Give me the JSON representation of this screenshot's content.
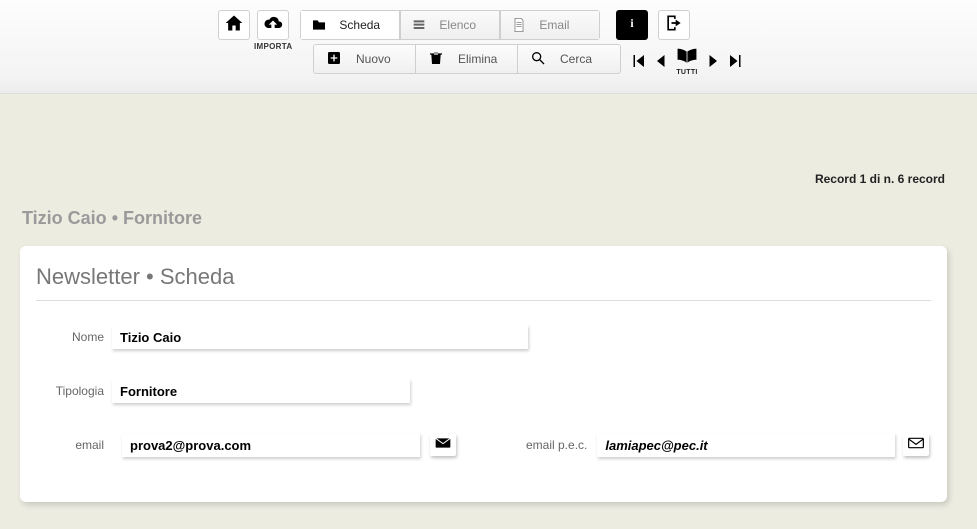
{
  "toolbar": {
    "import_label": "IMPORTA",
    "tabs": {
      "scheda": "Scheda",
      "elenco": "Elenco",
      "email": "Email"
    },
    "actions": {
      "nuovo": "Nuovo",
      "elimina": "Elimina",
      "cerca": "Cerca"
    },
    "tutti_label": "TUTTI"
  },
  "record_counter": "Record 1 di n. 6 record",
  "header": {
    "name": "Tizio Caio",
    "separator": " • ",
    "type": "Fornitore"
  },
  "card": {
    "title": "Newsletter • Scheda",
    "labels": {
      "nome": "Nome",
      "tipologia": "Tipologia",
      "email": "email",
      "email_pec": "email p.e.c."
    },
    "fields": {
      "nome": "Tizio Caio",
      "tipologia": "Fornitore",
      "email": "prova2@prova.com",
      "email_pec": "lamiapec@pec.it"
    }
  }
}
